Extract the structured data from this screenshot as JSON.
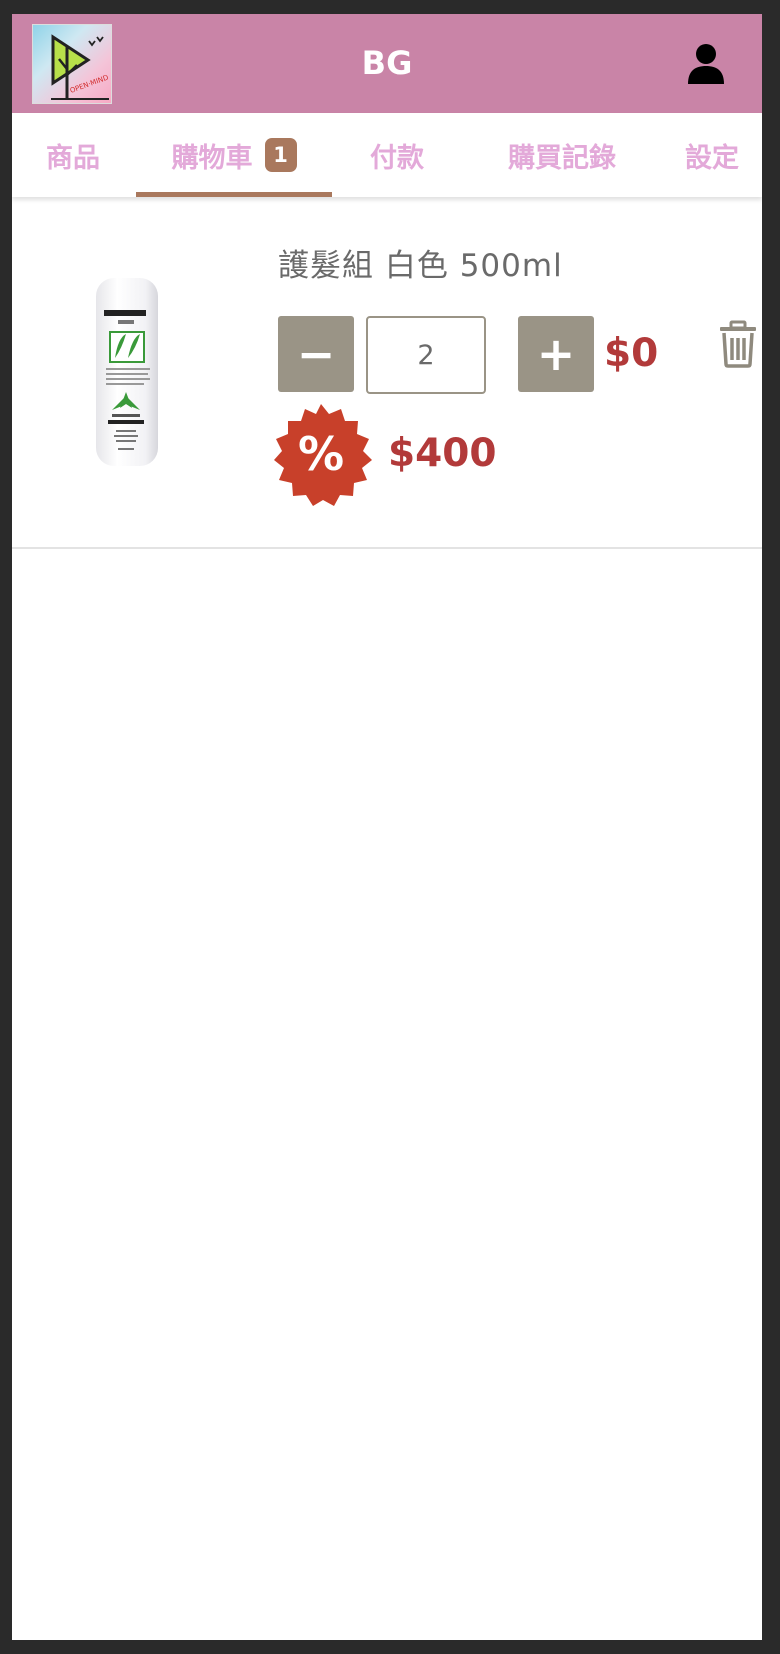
{
  "app": {
    "title": "BG"
  },
  "colors": {
    "header_bg": "#c984a7",
    "tab_text": "#e3a9d9",
    "tab_active_underline": "#a9785d",
    "badge_bg": "#a9785d",
    "qty_button_bg": "#9a9486",
    "price_color": "#b23a3a",
    "discount_icon_color": "#c8402a"
  },
  "icons": {
    "user": "user-icon",
    "minus": "minus-icon",
    "plus": "plus-icon",
    "trash": "trash-icon",
    "discount": "percent-badge-icon"
  },
  "tabs": [
    {
      "label": "商品"
    },
    {
      "label": "購物車",
      "badge": "1",
      "active": true
    },
    {
      "label": "付款"
    },
    {
      "label": "購買記錄"
    },
    {
      "label": "設定"
    }
  ],
  "cart": {
    "items": [
      {
        "name": "護髮組 白色 500ml",
        "quantity": "2",
        "minus_label": "−",
        "plus_label": "+",
        "price": "$0",
        "original_price": "$400",
        "discount_symbol": "%"
      }
    ]
  }
}
